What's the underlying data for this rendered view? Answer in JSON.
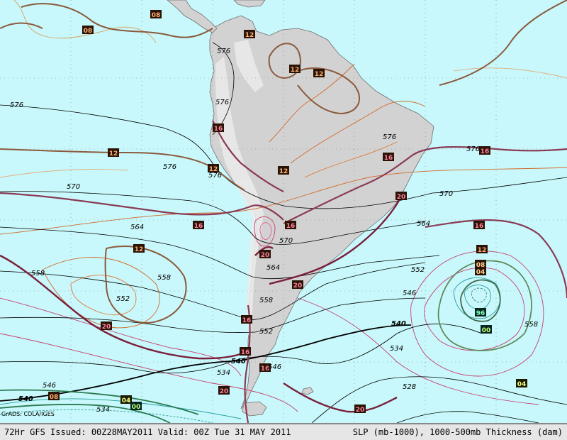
{
  "footer": {
    "left": "72Hr GFS Issued: 00Z28MAY2011 Valid: 00Z Tue 31 MAY 2011",
    "right": "SLP (mb-1000), 1000-500mb Thickness (dam)"
  },
  "credit": "GrADS: COLA/IGES",
  "colors": {
    "ocean": "#c8f8fb",
    "land": "#d2d2d2",
    "graticule": "#7a7a7a",
    "thickness": "#000000",
    "isobar_12": "#8b5a3c",
    "isobar_16": "#8a3a55",
    "isobar_20": "#7a1f3a",
    "low_center": "#1e6e6e"
  },
  "isobar_labels": [
    "08",
    "08",
    "12",
    "12",
    "12",
    "12",
    "12",
    "12",
    "12",
    "16",
    "16",
    "16",
    "16",
    "16",
    "16",
    "16",
    "16",
    "16",
    "20",
    "20",
    "20",
    "20",
    "20",
    "20",
    "12",
    "08",
    "04",
    "96",
    "00",
    "04",
    "08",
    "04",
    "00"
  ],
  "thickness_labels": [
    "576",
    "576",
    "576",
    "576",
    "576",
    "576",
    "576",
    "570",
    "570",
    "570",
    "564",
    "564",
    "564",
    "558",
    "558",
    "558",
    "558",
    "552",
    "552",
    "552",
    "546",
    "546",
    "546",
    "540",
    "540",
    "540",
    "534",
    "534",
    "534",
    "528"
  ]
}
